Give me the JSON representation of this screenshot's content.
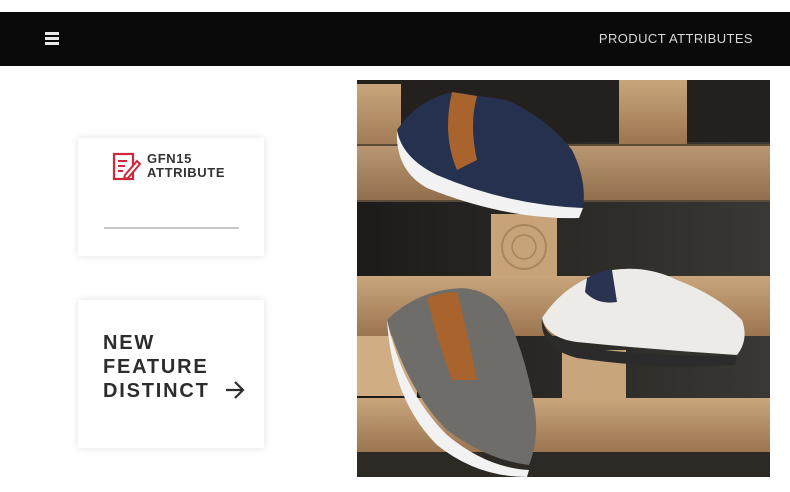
{
  "header": {
    "title": "PRODUCT ATTRIBUTES",
    "menu_icon": "menu-icon",
    "background": "#0a0a0a"
  },
  "attribute_card": {
    "icon": "document-edit-icon",
    "icon_color": "#d0273a",
    "line1": "GFN15",
    "line2": "ATTRIBUTE"
  },
  "feature_card": {
    "line1": "NEW",
    "line2": "FEATURE",
    "line3": "DISTINCT",
    "arrow_icon": "arrow-right-icon"
  },
  "product_image": {
    "subject": "three sneakers (navy, grey, white) on wooden pallet boards"
  }
}
